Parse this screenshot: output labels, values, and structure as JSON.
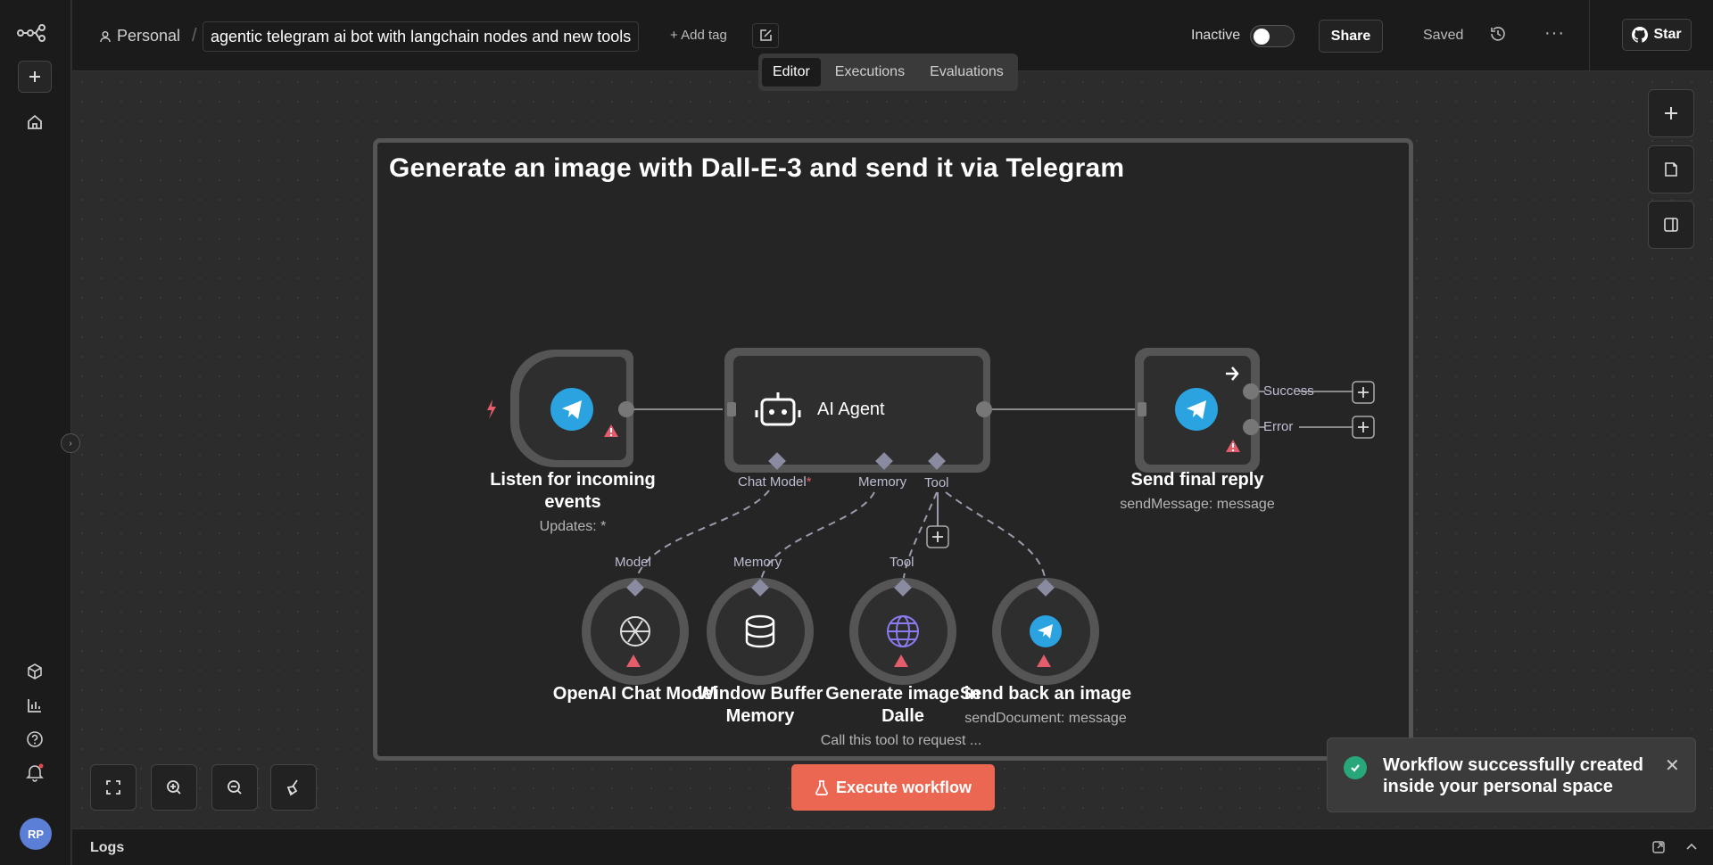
{
  "breadcrumb": {
    "owner": "Personal",
    "separator": "/"
  },
  "workflow": {
    "name": "agentic telegram ai bot with langchain nodes and new tools",
    "add_tag": "+ Add tag"
  },
  "tabs": [
    {
      "label": "Editor"
    },
    {
      "label": "Executions"
    },
    {
      "label": "Evaluations"
    }
  ],
  "header": {
    "status_label": "Inactive",
    "share_label": "Share",
    "saved_label": "Saved",
    "star_label": "Star",
    "more": "···"
  },
  "sticky": {
    "title": "Generate an image with Dall-E-3 and send it via Telegram"
  },
  "nodes": {
    "trigger": {
      "label": "Listen for incoming events",
      "sub": "Updates: *"
    },
    "agent": {
      "label": "AI Agent",
      "ports": {
        "chat_model": "Chat Model",
        "required": "*",
        "memory": "Memory",
        "tool": "Tool"
      }
    },
    "reply": {
      "label": "Send final reply",
      "sub": "sendMessage: message",
      "outputs": {
        "success": "Success",
        "error": "Error"
      }
    },
    "openai": {
      "label": "OpenAI Chat Model",
      "port": "Model"
    },
    "memory": {
      "label_1": "Window Buffer",
      "label_2": "Memory",
      "port": "Memory"
    },
    "dalle": {
      "label_1": "Generate image in",
      "label_2": "Dalle",
      "sub": "Call this tool to request ...",
      "port": "Tool"
    },
    "send_image": {
      "label": "Send back an image",
      "sub": "sendDocument: message"
    }
  },
  "execute_button": "Execute workflow",
  "toast": {
    "message": "Workflow successfully created inside your personal space"
  },
  "logs": {
    "label": "Logs"
  },
  "user": {
    "initials": "RP"
  },
  "colors": {
    "accent": "#ec6752",
    "telegram": "#2aa3e0",
    "success": "#28a87a",
    "warning": "#e55d6a"
  }
}
